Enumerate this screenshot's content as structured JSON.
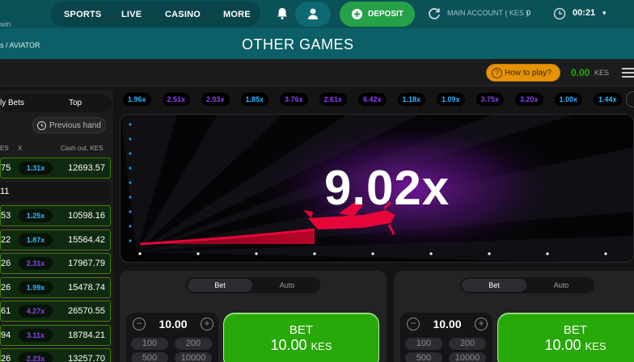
{
  "nav": {
    "items": [
      "SPORTS",
      "LIVE",
      "CASINO",
      "MORE"
    ],
    "deposit_label": "DEPOSIT",
    "account_label": "MAIN ACCOUNT ( KES )",
    "account_value": "0",
    "time": "00:21",
    "corner_logo": "win"
  },
  "breadcrumb": {
    "text": "s / AVIATOR",
    "title": "OTHER GAMES"
  },
  "game_header": {
    "how_to_play": "How to play?",
    "balance": "0.00",
    "currency": "KES"
  },
  "bets_panel": {
    "tab_all": "ly Bets",
    "tab_top": "Top",
    "previous_hand": "Previous hand",
    "col_bet": "ES",
    "col_x": "X",
    "col_cashout": "Cash out, KES",
    "rows": [
      {
        "amount": "75",
        "mult": "1.31x",
        "mult_color": "#34b4ff",
        "cashout": "12693.57",
        "win": true
      },
      {
        "amount": "11",
        "mult": "",
        "mult_color": "",
        "cashout": "",
        "win": false
      },
      {
        "amount": "53",
        "mult": "1.25x",
        "mult_color": "#34b4ff",
        "cashout": "10598.16",
        "win": true
      },
      {
        "amount": "22",
        "mult": "1.87x",
        "mult_color": "#34b4ff",
        "cashout": "15564.42",
        "win": true
      },
      {
        "amount": "26",
        "mult": "2.31x",
        "mult_color": "#913ef8",
        "cashout": "17967.79",
        "win": true
      },
      {
        "amount": "26",
        "mult": "1.99x",
        "mult_color": "#34b4ff",
        "cashout": "15478.74",
        "win": true
      },
      {
        "amount": "61",
        "mult": "4.27x",
        "mult_color": "#913ef8",
        "cashout": "26570.55",
        "win": true
      },
      {
        "amount": "94",
        "mult": "3.11x",
        "mult_color": "#913ef8",
        "cashout": "18784.21",
        "win": true
      },
      {
        "amount": "26",
        "mult": "2.23x",
        "mult_color": "#913ef8",
        "cashout": "13257.70",
        "win": true
      }
    ]
  },
  "history": [
    {
      "v": "1.96x",
      "c": "#34b4ff"
    },
    {
      "v": "2.51x",
      "c": "#913ef8"
    },
    {
      "v": "2.03x",
      "c": "#913ef8"
    },
    {
      "v": "1.85x",
      "c": "#34b4ff"
    },
    {
      "v": "3.76x",
      "c": "#913ef8"
    },
    {
      "v": "2.61x",
      "c": "#913ef8"
    },
    {
      "v": "6.42x",
      "c": "#913ef8"
    },
    {
      "v": "1.18x",
      "c": "#34b4ff"
    },
    {
      "v": "1.09x",
      "c": "#34b4ff"
    },
    {
      "v": "3.75x",
      "c": "#913ef8"
    },
    {
      "v": "3.20x",
      "c": "#913ef8"
    },
    {
      "v": "1.00x",
      "c": "#34b4ff"
    },
    {
      "v": "1.44x",
      "c": "#34b4ff"
    }
  ],
  "stage": {
    "multiplier": "9.02x"
  },
  "bet_panels": [
    {
      "mode_bet": "Bet",
      "mode_auto": "Auto",
      "stake": "10.00",
      "quick": [
        "100",
        "200",
        "500",
        "10000"
      ],
      "button_label": "BET",
      "button_amount": "10.00",
      "button_currency": "KES"
    },
    {
      "mode_bet": "Bet",
      "mode_auto": "Auto",
      "stake": "10.00",
      "quick": [
        "100",
        "200",
        "500",
        "10000"
      ],
      "button_label": "BET",
      "button_amount": "10.00",
      "button_currency": "KES"
    }
  ],
  "colors": {
    "accent_green": "#28a909",
    "nav_teal": "#0a5158",
    "plane_red": "#e50539",
    "blue_mult": "#34b4ff",
    "purple_mult": "#913ef8"
  }
}
